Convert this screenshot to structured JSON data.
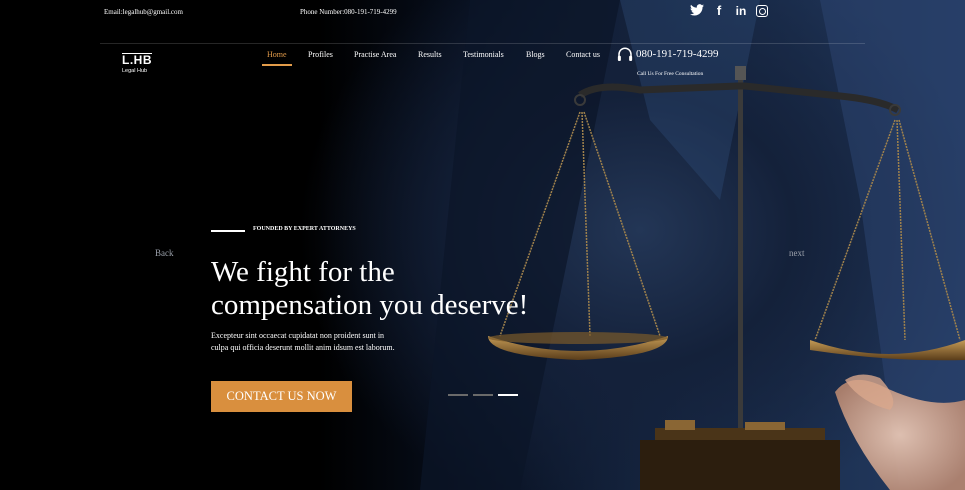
{
  "topbar": {
    "email": "Email:legalhub@gmail.com",
    "phone": "Phone Number:080-191-719-4299",
    "social": [
      "twitter-icon",
      "facebook-icon",
      "linkedin-icon",
      "instagram-icon"
    ]
  },
  "logo": {
    "mark": "L.HB",
    "sub": "Legal Hub"
  },
  "nav": {
    "items": [
      {
        "label": "Home",
        "active": true
      },
      {
        "label": "Profiles"
      },
      {
        "label": "Practise Area"
      },
      {
        "label": "Results"
      },
      {
        "label": "Testimonials"
      },
      {
        "label": "Blogs"
      },
      {
        "label": "Contact us"
      }
    ]
  },
  "call": {
    "number": "080-191-719-4299",
    "caption": "Call Us For Free Consultation",
    "icon": "headset-icon"
  },
  "hero": {
    "eyebrow": "FOUNDED BY EXPERT ATTORNEYS",
    "headline_line1": "We fight for the",
    "headline_line2": "compensation you deserve!",
    "description_line1": "Excepteur sint occaecat cupidatat non proident sunt in",
    "description_line2": "culpa qui officia deserunt mollit anim idsum est laborum.",
    "cta": "CONTACT US NOW",
    "back": "Back",
    "next": "next",
    "slides_total": 3,
    "slide_active": 3
  },
  "colors": {
    "accent": "#e39c4a",
    "button": "#d98f3e"
  }
}
